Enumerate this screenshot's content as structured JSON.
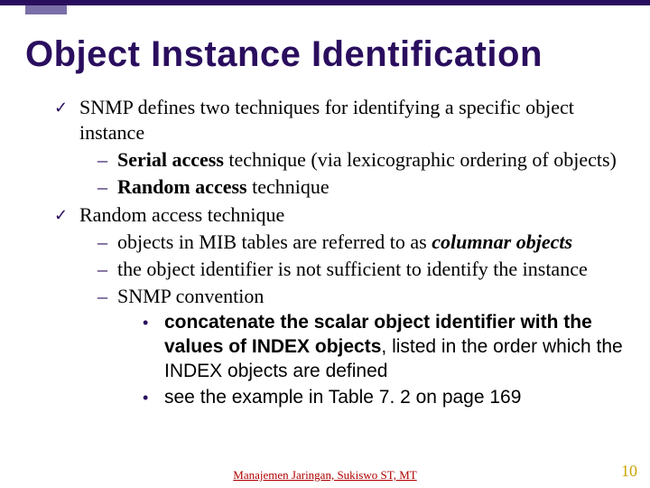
{
  "title": "Object Instance Identification",
  "bullets": {
    "b1": "SNMP defines two techniques for identifying a specific object instance",
    "b1a_bold": "Serial access",
    "b1a_rest": " technique (via lexicographic ordering of objects)",
    "b1b_bold": "Random access",
    "b1b_rest": " technique",
    "b2": "Random access technique",
    "b2a_pre": "objects in MIB tables are referred to as ",
    "b2a_ital": "columnar objects",
    "b2b": "the object identifier is not sufficient to identify the instance",
    "b2c": "SNMP convention",
    "b2c1_bold": "concatenate the scalar object identifier with the values of INDEX objects",
    "b2c1_rest": ", listed in the order which the INDEX objects are defined",
    "b2c2": "see the example in Table 7. 2 on page 169"
  },
  "footer": "Manajemen Jaringan, Sukiswo ST, MT",
  "page_number": "10"
}
